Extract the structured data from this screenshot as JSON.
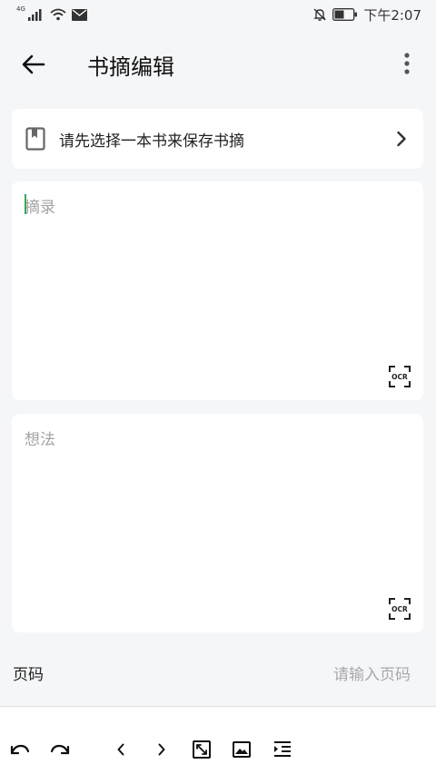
{
  "status_bar": {
    "network": "4G",
    "time": "下午2:07",
    "icons": [
      "signal-icon",
      "wifi-icon",
      "mail-icon",
      "mute-bell-icon",
      "battery-icon"
    ]
  },
  "header": {
    "title": "书摘编辑",
    "icons": [
      "back-arrow-icon",
      "more-vert-icon"
    ]
  },
  "book_select": {
    "label": "请先选择一本书来保存书摘",
    "icons": [
      "book-icon",
      "chevron-right-icon"
    ]
  },
  "excerpt": {
    "placeholder": "摘录",
    "ocr_label": "OCR"
  },
  "thought": {
    "placeholder": "想法",
    "ocr_label": "OCR"
  },
  "page": {
    "label": "页码",
    "placeholder": "请输入页码"
  },
  "toolbar": {
    "icons": [
      "undo-icon",
      "redo-icon",
      "chevron-left-icon",
      "chevron-right-icon",
      "fullscreen-icon",
      "image-icon",
      "indent-icon"
    ]
  },
  "colors": {
    "background": "#f5f6f8",
    "card": "#ffffff",
    "cursor": "#3aa757",
    "placeholder": "#a3a3a3"
  }
}
